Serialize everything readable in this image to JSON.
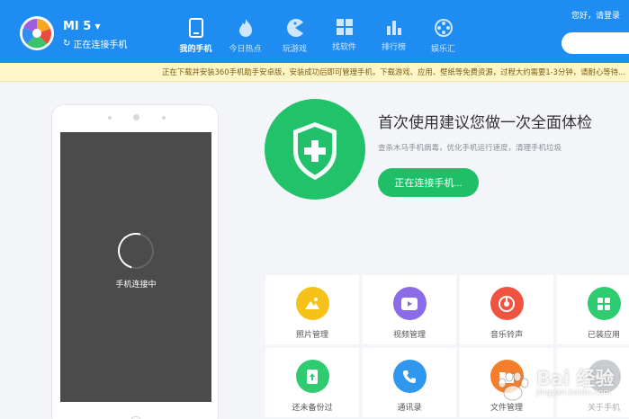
{
  "header": {
    "device_name": "MI 5",
    "device_status": "正在连接手机",
    "greeting": "您好，请登录",
    "nav": [
      {
        "label": "我的手机",
        "icon": "phone-icon"
      },
      {
        "label": "今日热点",
        "icon": "flame-icon"
      },
      {
        "label": "玩游戏",
        "icon": "pacman-icon"
      },
      {
        "label": "找软件",
        "icon": "apps-grid-icon"
      },
      {
        "label": "排行榜",
        "icon": "bar-chart-icon"
      },
      {
        "label": "娱乐汇",
        "icon": "film-reel-icon"
      }
    ]
  },
  "notice": "正在下载并安装360手机助手安卓版，安装成功后即可管理手机，下载游戏、应用、壁纸等免费资源，过程大约需要1-3分钟，请耐心等待...",
  "phone": {
    "screen_text": "手机连接中"
  },
  "hero": {
    "title": "首次使用建议您做一次全面体检",
    "subtitle": "查杀木马手机病毒，优化手机运行速度，清理手机垃圾",
    "button": "正在连接手机..."
  },
  "tiles": [
    {
      "label": "照片管理",
      "icon": "photo-icon",
      "color": "#f6c21a"
    },
    {
      "label": "视频管理",
      "icon": "video-play-icon",
      "color": "#8c6be8"
    },
    {
      "label": "音乐铃声",
      "icon": "music-disc-icon",
      "color": "#f0533f"
    },
    {
      "label": "已装应用",
      "icon": "installed-apps-icon",
      "color": "#2ecb71"
    },
    {
      "label": "还未备份过",
      "icon": "backup-icon",
      "color": "#2ecb71"
    },
    {
      "label": "通讯录",
      "icon": "contacts-phone-icon",
      "color": "#2f97f0"
    },
    {
      "label": "文件管理",
      "icon": "file-manager-icon",
      "color": "#f47e2a"
    },
    {
      "label": "关于手机",
      "icon": "more-icon",
      "color": "#c9ccd0"
    }
  ],
  "watermark": {
    "text": "Bai 经验",
    "url": "jingyan.baidu.com"
  },
  "colors": {
    "header_blue": "#1e8cf0",
    "primary_green": "#1fbf68",
    "notice_yellow": "#fff6c8"
  }
}
